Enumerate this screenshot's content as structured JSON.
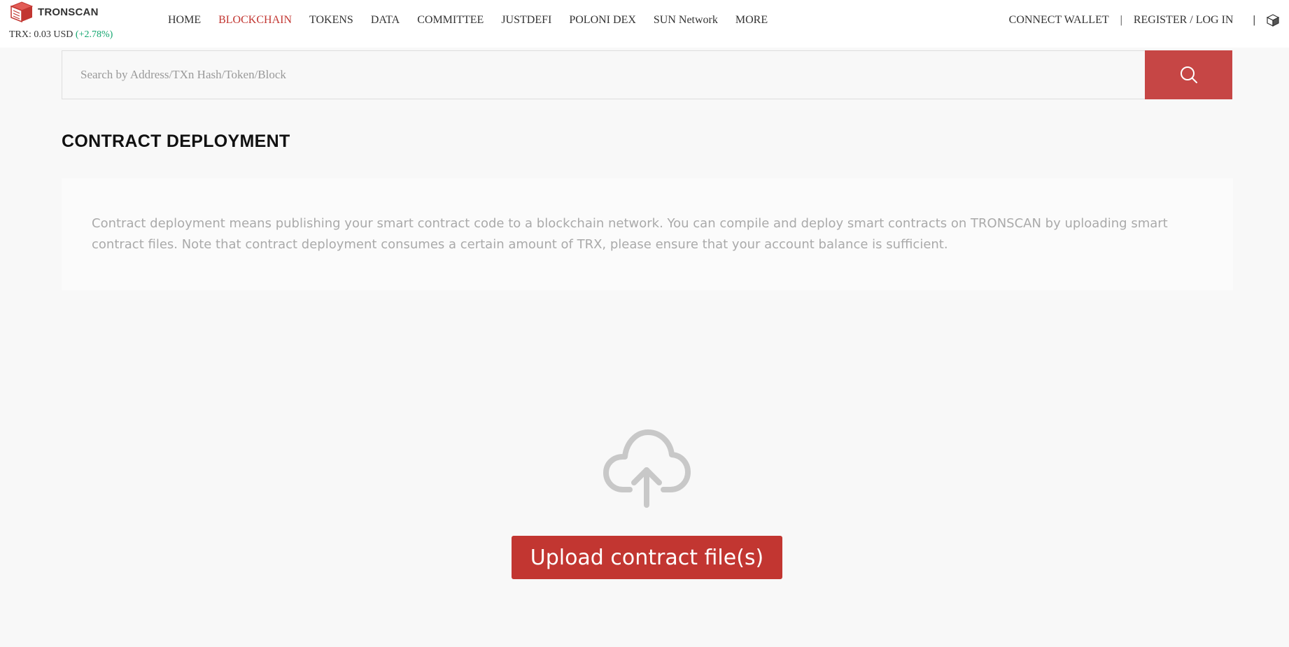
{
  "brand": {
    "name": "TRONSCAN"
  },
  "price": {
    "label": "TRX:",
    "value": "0.03",
    "unit": "USD",
    "change": "(+2.78%)"
  },
  "nav": {
    "items": [
      "HOME",
      "BLOCKCHAIN",
      "TOKENS",
      "DATA",
      "COMMITTEE",
      "JUSTDEFI",
      "POLONI DEX",
      "SUN Network",
      "MORE"
    ],
    "active": "BLOCKCHAIN"
  },
  "header_right": {
    "connect_wallet": "CONNECT WALLET",
    "separator": "|",
    "register_login": "REGISTER / LOG IN"
  },
  "search": {
    "placeholder": "Search by Address/TXn Hash/Token/Block",
    "value": ""
  },
  "page": {
    "title": "CONTRACT DEPLOYMENT",
    "description": "Contract deployment means publishing your smart contract code to a blockchain network. You can compile and deploy smart contracts on TRONSCAN by uploading smart contract files. Note that contract deployment consumes a certain amount of TRX, please ensure that your account balance is sufficient."
  },
  "upload": {
    "button_label": "Upload contract file(s)"
  },
  "icons": {
    "logo": "tronscan-logo-icon",
    "search": "search-icon",
    "upload": "cloud-upload-icon",
    "language": "cube-icon"
  },
  "colors": {
    "accent": "#c23631",
    "search_button": "#c64645",
    "positive": "#11a56e",
    "background": "#f8f8f8"
  }
}
